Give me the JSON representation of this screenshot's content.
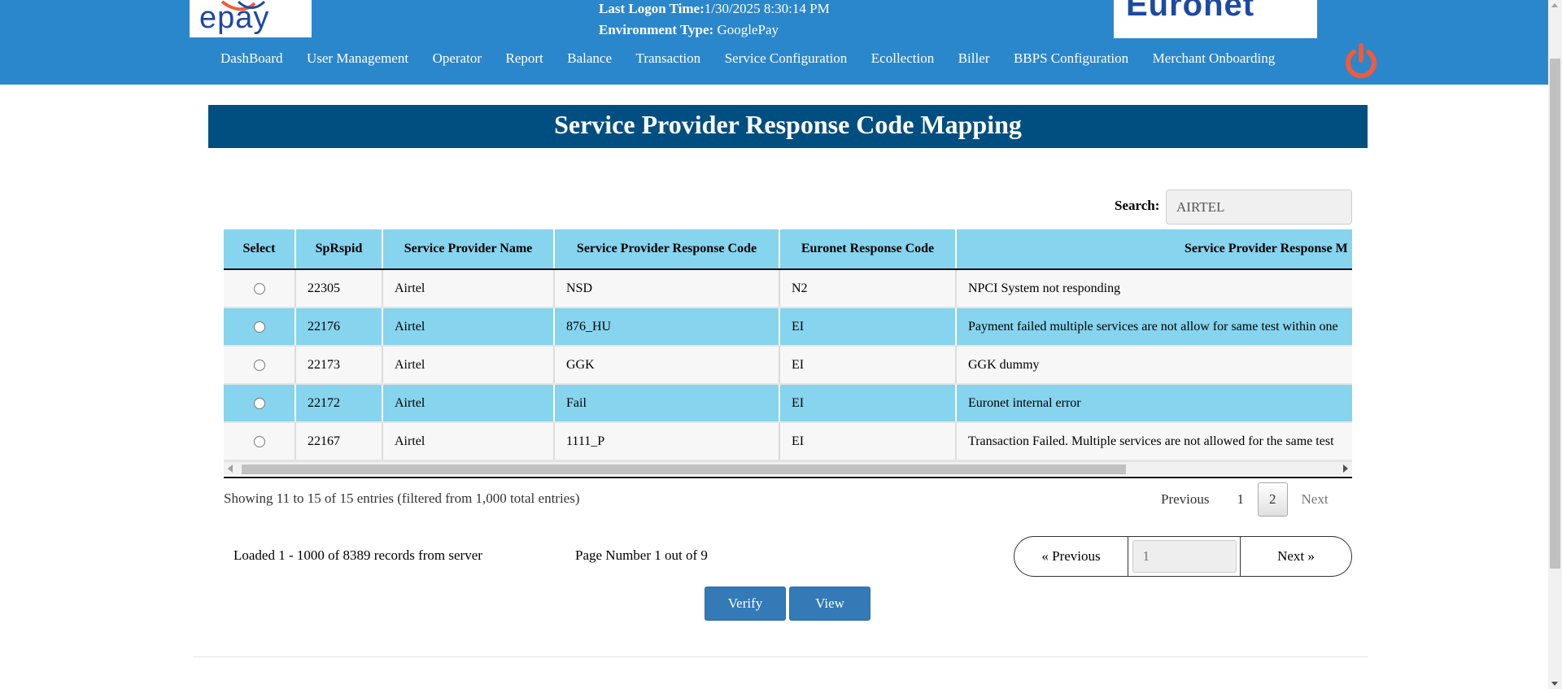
{
  "header": {
    "logo_left": "epay",
    "logo_right": "Euronet",
    "last_logon_label": "Last Logon Time:",
    "last_logon_value": "1/30/2025 8:30:14 PM",
    "environment_label": "Environment Type:",
    "environment_value": "GooglePay",
    "power_icon": "power-icon",
    "colors": {
      "header_bg": "#2b87cb",
      "power": "#f15a3a"
    }
  },
  "nav": {
    "items": [
      {
        "label": "DashBoard"
      },
      {
        "label": "User Management"
      },
      {
        "label": "Operator"
      },
      {
        "label": "Report"
      },
      {
        "label": "Balance"
      },
      {
        "label": "Transaction"
      },
      {
        "label": "Service Configuration"
      },
      {
        "label": "Ecollection"
      },
      {
        "label": "Biller"
      },
      {
        "label": "BBPS Configuration"
      },
      {
        "label": "Merchant Onboarding"
      }
    ]
  },
  "page": {
    "title": "Service Provider Response Code Mapping",
    "title_bg": "#004f80"
  },
  "search": {
    "label": "Search:",
    "value": "AIRTEL"
  },
  "table": {
    "columns": [
      "Select",
      "SpRspid",
      "Service Provider Name",
      "Service Provider Response Code",
      "Euronet Response Code",
      "Service Provider Response M"
    ],
    "rows": [
      {
        "id": "22305",
        "name": "Airtel",
        "sp_code": "NSD",
        "euronet_code": "N2",
        "message": "NPCI System not responding"
      },
      {
        "id": "22176",
        "name": "Airtel",
        "sp_code": "876_HU",
        "euronet_code": "EI",
        "message": "Payment failed multiple services are not allow for same test within one"
      },
      {
        "id": "22173",
        "name": "Airtel",
        "sp_code": "GGK",
        "euronet_code": "EI",
        "message": "GGK dummy"
      },
      {
        "id": "22172",
        "name": "Airtel",
        "sp_code": "Fail",
        "euronet_code": "EI",
        "message": "Euronet internal error"
      },
      {
        "id": "22167",
        "name": "Airtel",
        "sp_code": "1111_P",
        "euronet_code": "EI",
        "message": "Transaction Failed. Multiple services are not allowed for the same test"
      }
    ],
    "header_bg": "#87d4ee"
  },
  "pagination": {
    "entries_info": "Showing 11 to 15 of 15 entries (filtered from 1,000 total entries)",
    "previous": "Previous",
    "pages": [
      "1",
      "2"
    ],
    "current_page": "2",
    "next": "Next"
  },
  "server_paging": {
    "loaded_info": "Loaded 1 - 1000 of 8389 records from server",
    "page_number_info": "Page Number 1 out of 9",
    "previous": "«  Previous",
    "page_input_placeholder": "1",
    "next": "Next  »"
  },
  "actions": {
    "verify": "Verify",
    "view": "View",
    "button_color": "#337ab7"
  }
}
